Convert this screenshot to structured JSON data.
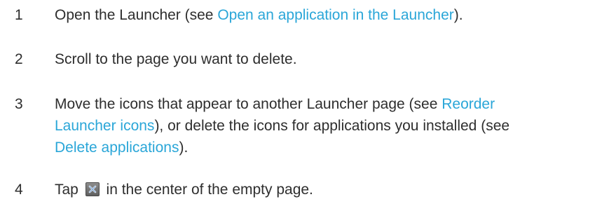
{
  "steps": [
    {
      "number": "1",
      "text_before": "Open the Launcher (see ",
      "link": "Open an application in the Launcher",
      "text_after": ")."
    },
    {
      "number": "2",
      "text": "Scroll to the page you want to delete."
    },
    {
      "number": "3",
      "line1_before": "Move the icons that appear to another Launcher page (see ",
      "link1_part1": "Reorder",
      "link1_part2": "Launcher icons",
      "line2_middle": "), or delete the icons for applications you installed (see",
      "link2": "Delete applications",
      "text_after": ")."
    },
    {
      "number": "4",
      "text_before": "Tap ",
      "icon": "delete-page-icon",
      "text_after": " in the center of the empty page."
    }
  ]
}
